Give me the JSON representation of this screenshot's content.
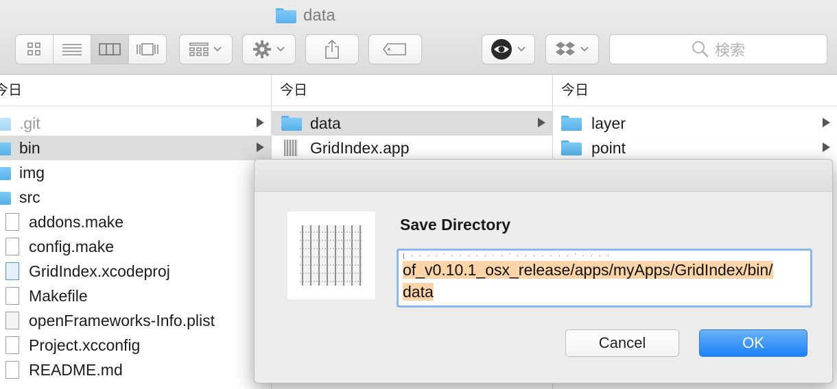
{
  "window": {
    "title": "data",
    "icon": "folder-icon"
  },
  "toolbar": {
    "view_modes": [
      {
        "name": "icon-view",
        "icon": "grid-icon"
      },
      {
        "name": "list-view",
        "icon": "list-icon"
      },
      {
        "name": "column-view",
        "icon": "columns-icon",
        "selected": true
      },
      {
        "name": "gallery-view",
        "icon": "coverflow-icon"
      }
    ],
    "search_placeholder": "検索",
    "accent": "#1a82f7"
  },
  "columns": [
    {
      "header": "今日",
      "items": [
        {
          "label": ".git",
          "kind": "folder",
          "dimmed": true,
          "has_children": true
        },
        {
          "label": "bin",
          "kind": "folder",
          "selected": true,
          "has_children": true
        },
        {
          "label": "img",
          "kind": "folder"
        },
        {
          "label": "src",
          "kind": "folder"
        },
        {
          "label": "addons.make",
          "kind": "file"
        },
        {
          "label": "config.make",
          "kind": "file"
        },
        {
          "label": "GridIndex.xcodeproj",
          "kind": "xcodeproj"
        },
        {
          "label": "Makefile",
          "kind": "file"
        },
        {
          "label": "openFrameworks-Info.plist",
          "kind": "plist"
        },
        {
          "label": "Project.xcconfig",
          "kind": "xcconfig"
        },
        {
          "label": "README.md",
          "kind": "file"
        }
      ]
    },
    {
      "header": "今日",
      "items": [
        {
          "label": "data",
          "kind": "folder",
          "selected": true,
          "has_children": true
        },
        {
          "label": "GridIndex.app",
          "kind": "app"
        }
      ]
    },
    {
      "header": "今日",
      "items": [
        {
          "label": "layer",
          "kind": "folder",
          "has_children": true
        },
        {
          "label": "point",
          "kind": "folder",
          "has_children": true
        }
      ]
    }
  ],
  "dialog": {
    "title": "Save Directory",
    "path_line1": "of_v0.10.1_osx_release/apps/myApps/GridIndex/bin/",
    "path_line2": "data",
    "cancel_label": "Cancel",
    "ok_label": "OK"
  }
}
